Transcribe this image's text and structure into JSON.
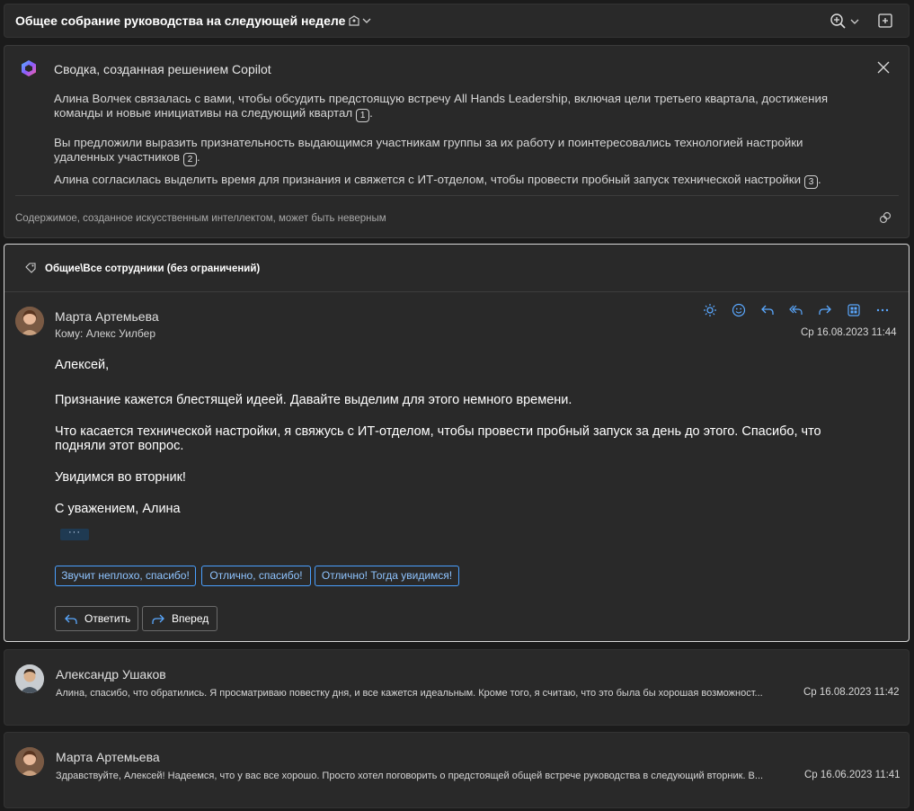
{
  "header": {
    "title": "Общее собрание руководства на следующей неделе"
  },
  "summary": {
    "title": "Сводка, созданная решением Copilot",
    "paragraphs": [
      {
        "line1": "Алина Волчек связалась с вами, чтобы обсудить предстоящую встречу All Hands Leadership, включая цели третьего квартала, достижения",
        "line2": "команды и новые инициативы на следующий квартал",
        "ref": "1"
      },
      {
        "line1": "Вы предложили выразить признательность выдающимся участникам группы за их работу и поинтересовались технологией настройки",
        "line2": "удаленных участников",
        "ref": "2"
      },
      {
        "line1": "Алина согласилась выделить время для признания и свяжется с ИТ-отделом, чтобы провести пробный запуск технической настройки",
        "ref": "3"
      }
    ],
    "disclaimer": "Содержимое, созданное искусственным интеллектом, может быть неверным"
  },
  "main_message": {
    "category": "Общие\\Все сотрудники (без ограничений)",
    "sender": "Марта Артемьева",
    "to": "Кому: Алекс Уилбер",
    "date": "Ср 16.08.2023 11:44",
    "body": {
      "greeting": "Алексей,",
      "p1": "Признание кажется блестящей идеей. Давайте выделим для этого немного времени.",
      "p2_line1": "Что касается технической настройки, я свяжусь с ИТ-отделом, чтобы провести пробный запуск за день до этого. Спасибо, что",
      "p2_line2": "подняли этот вопрос.",
      "p3": "Увидимся во вторник!",
      "signoff": "С уважением, Алина"
    },
    "more": "···",
    "suggestions": [
      "Звучит неплохо, спасибо!",
      "Отлично, спасибо!",
      "Отлично! Тогда увидимся!"
    ],
    "reply_label": "Ответить",
    "forward_label": "Вперед"
  },
  "collapsed_messages": [
    {
      "sender": "Александр Ушаков",
      "preview": "Алина, спасибо, что обратились. Я просматриваю повестку дня, и все кажется идеальным. Кроме того, я считаю, что это была бы хорошая возможност...",
      "date": "Ср 16.08.2023 11:42"
    },
    {
      "sender": "Марта Артемьева",
      "preview": "Здравствуйте, Алексей! Надеемся, что у вас все хорошо. Просто хотел поговорить о предстоящей общей встрече руководства в следующий вторник. В...",
      "date": "Ср 16.06.2023 11:41"
    }
  ],
  "colors": {
    "accent": "#5aa8ff",
    "background": "#1b1b1b",
    "card": "#292929"
  }
}
